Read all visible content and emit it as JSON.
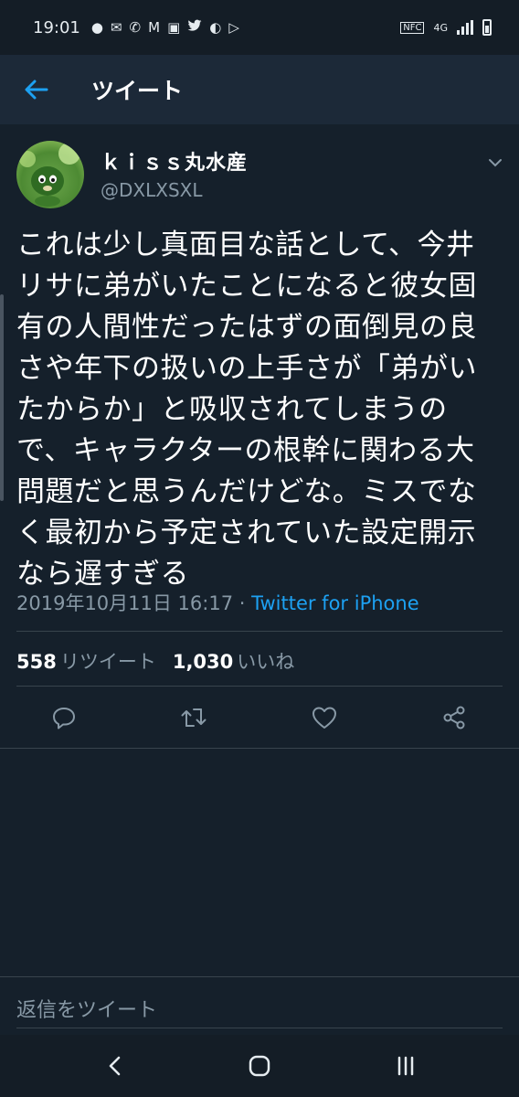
{
  "status_bar": {
    "time": "19:01",
    "notification_icons": [
      "chat-bubble-icon",
      "mail-icon",
      "missed-call-icon",
      "gmail-icon",
      "image-icon",
      "twitter-icon",
      "app-icon",
      "play-store-icon"
    ],
    "nfc": "NFC",
    "network": "4G"
  },
  "header": {
    "title": "ツイート",
    "back_icon": "arrow-left-icon"
  },
  "tweet": {
    "display_name": "ｋｉｓｓ丸水産",
    "handle": "@DXLXSXL",
    "lines": [
      "これは少し真面目な話として、今井",
      "リサに弟がいたことになると彼女固",
      "有の人間性だったはずの面倒見の良",
      "さや年下の扱いの上手さが「弟がい",
      "たからか」と吸収されてしまうの",
      "で、キャラクターの根幹に関わる大",
      "問題だと思うんだけどな。ミスでな",
      "く最初から予定されていた設定開示",
      "なら遅すぎる"
    ],
    "timestamp": "2019年10月11日 16:17",
    "separator": " · ",
    "source": "Twitter for iPhone",
    "retweets_count": "558",
    "retweets_label": "リツイート",
    "likes_count": "1,030",
    "likes_label": "いいね"
  },
  "actions": {
    "reply": "reply-icon",
    "retweet": "retweet-icon",
    "like": "heart-icon",
    "share": "share-icon"
  },
  "reply_bar": {
    "placeholder": "返信をツイート"
  },
  "colors": {
    "background": "#15202b",
    "header": "#1c2938",
    "accent": "#1da1f2",
    "secondary_text": "#8899a6",
    "divider": "#38444d"
  }
}
